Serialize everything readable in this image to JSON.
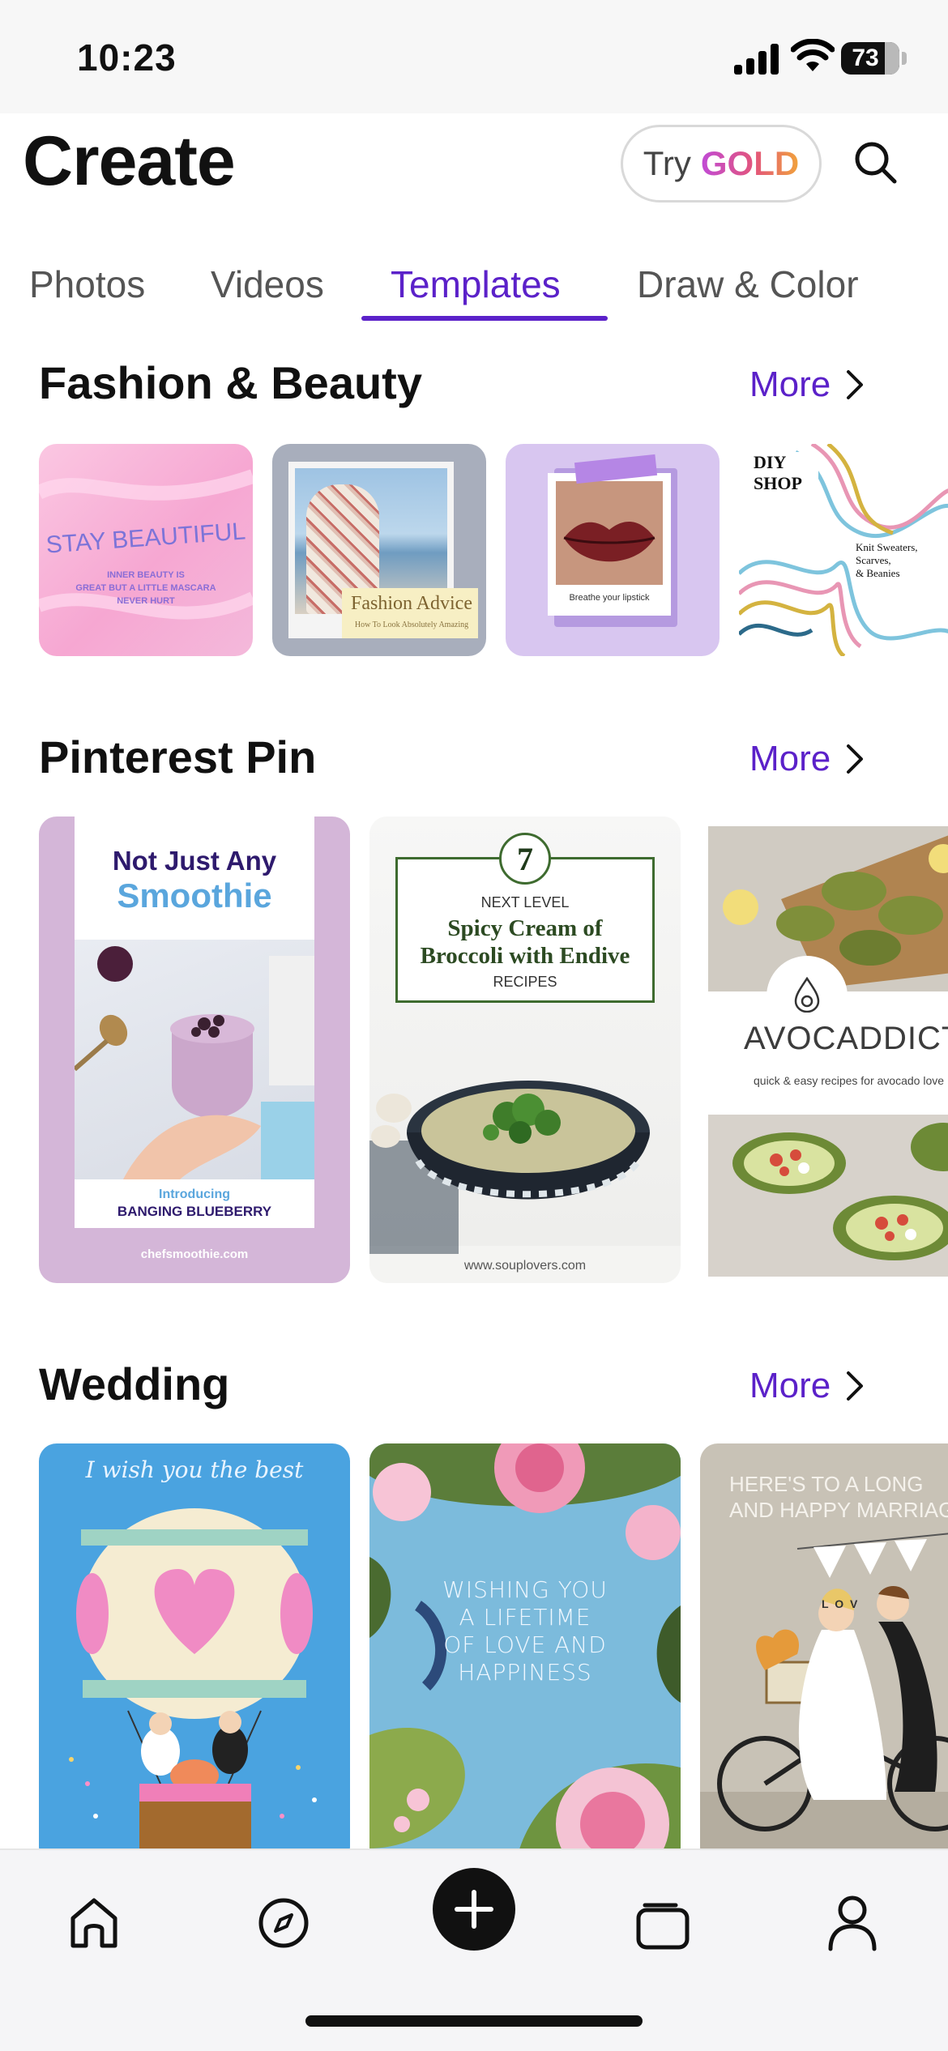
{
  "status": {
    "time": "10:23",
    "battery": "73"
  },
  "header": {
    "title": "Create",
    "try_label": "Try",
    "gold_label": "GOLD"
  },
  "tabs": [
    {
      "label": "Photos"
    },
    {
      "label": "Videos"
    },
    {
      "label": "Templates",
      "active": true
    },
    {
      "label": "Draw & Color"
    }
  ],
  "sections": [
    {
      "title": "Fashion & Beauty",
      "more": "More",
      "cards": [
        {
          "line1": "STAY BEAUTIFUL",
          "line2": "INNER BEAUTY IS",
          "line3": "GREAT BUT A LITTLE MASCARA",
          "line4": "NEVER HURT"
        },
        {
          "title": "Fashion Advice",
          "subtitle": "How To Look Absolutely Amazing"
        },
        {
          "caption": "Breathe your lipstick"
        },
        {
          "line1": "DIY",
          "line2": "SHOP",
          "line3": "Knit Sweaters,",
          "line4": "Scarves,",
          "line5": "& Beanies"
        }
      ]
    },
    {
      "title": "Pinterest Pin",
      "more": "More",
      "cards": [
        {
          "line1": "Not Just Any",
          "line2": "Smoothie",
          "line3": "Introducing",
          "line4": "BANGING BLUEBERRY",
          "footer": "chefsmoothie.com"
        },
        {
          "number": "7",
          "line1": "NEXT LEVEL",
          "line2": "Spicy Cream of",
          "line3": "Broccoli with Endive",
          "line4": "RECIPES",
          "footer": "www.souplovers.com"
        },
        {
          "title": "AVOCADDICTE",
          "subtitle": "quick & easy recipes for avocado love"
        }
      ]
    },
    {
      "title": "Wedding",
      "more": "More",
      "cards": [
        {
          "line1": "I wish you the best"
        },
        {
          "line1": "WISHING YOU",
          "line2": "A LIFETIME",
          "line3": "OF LOVE AND",
          "line4": "HAPPINESS"
        },
        {
          "line1": "HERE'S TO A LONG",
          "line2": "AND HAPPY MARRIAGE",
          "banner": "L  O  V"
        }
      ]
    }
  ],
  "nav": [
    {
      "icon": "home-icon"
    },
    {
      "icon": "compass-icon"
    },
    {
      "icon": "plus-icon"
    },
    {
      "icon": "stack-icon"
    },
    {
      "icon": "profile-icon"
    }
  ],
  "colors": {
    "accent": "#5b21c9",
    "bg": "#ffffff",
    "nav_bg": "#f5f5f7"
  }
}
